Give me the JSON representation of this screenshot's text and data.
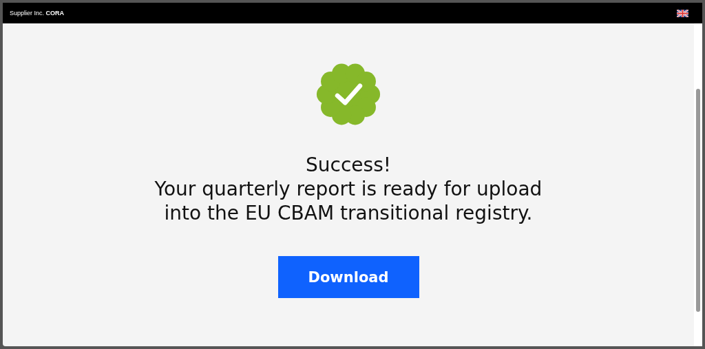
{
  "header": {
    "title": "Supplier Inc. **CORA**"
  },
  "message": {
    "heading": "Success!",
    "lines": [
      "Your quarterly report is ready for upload",
      "into the EU CBAM transitional registry."
    ]
  },
  "button": {
    "label": "Download"
  }
}
